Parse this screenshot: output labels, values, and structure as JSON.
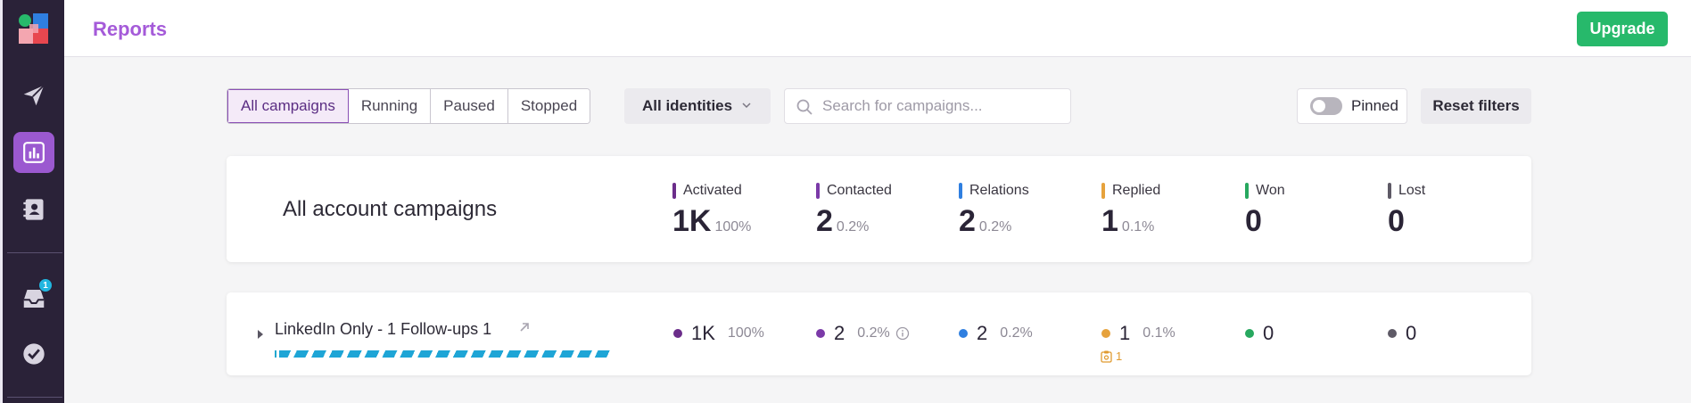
{
  "app": {
    "title": "Reports",
    "upgrade_label": "Upgrade"
  },
  "sidebar": {
    "items": [
      {
        "name": "campaigns",
        "icon": "paper-plane-icon"
      },
      {
        "name": "reports",
        "icon": "bar-chart-icon",
        "active": true
      },
      {
        "name": "contacts",
        "icon": "contact-book-icon"
      },
      {
        "name": "inbox",
        "icon": "inbox-icon",
        "badge": "1"
      },
      {
        "name": "tasks",
        "icon": "check-circle-icon"
      }
    ]
  },
  "filters": {
    "tabs": [
      "All campaigns",
      "Running",
      "Paused",
      "Stopped"
    ],
    "active_tab": "All campaigns",
    "identities_label": "All identities",
    "search_placeholder": "Search for campaigns...",
    "pinned_label": "Pinned",
    "pinned_on": false,
    "reset_label": "Reset filters"
  },
  "summary": {
    "title": "All account campaigns",
    "stats": [
      {
        "label": "Activated",
        "value": "1K",
        "pct": "100%",
        "color": "#6b2d8a"
      },
      {
        "label": "Contacted",
        "value": "2",
        "pct": "0.2%",
        "color": "#7b3aa8"
      },
      {
        "label": "Relations",
        "value": "2",
        "pct": "0.2%",
        "color": "#2f7fe0"
      },
      {
        "label": "Replied",
        "value": "1",
        "pct": "0.1%",
        "color": "#e6a23c"
      },
      {
        "label": "Won",
        "value": "0",
        "pct": "",
        "color": "#27a85f"
      },
      {
        "label": "Lost",
        "value": "0",
        "pct": "",
        "color": "#5e5a66"
      }
    ]
  },
  "campaigns": [
    {
      "name": "LinkedIn Only - 1 Follow-ups 1",
      "progress": 1.0,
      "activated": {
        "value": "1K",
        "pct": "100%",
        "color": "#6b2d8a"
      },
      "contacted": {
        "value": "2",
        "pct": "0.2%",
        "color": "#7b3aa8"
      },
      "relations": {
        "value": "2",
        "pct": "0.2%",
        "color": "#2f7fe0"
      },
      "replied": {
        "value": "1",
        "pct": "0.1%",
        "color": "#e6a23c",
        "sub": "1"
      },
      "won": {
        "value": "0",
        "color": "#27a85f"
      },
      "lost": {
        "value": "0",
        "color": "#5e5a66"
      }
    }
  ]
}
